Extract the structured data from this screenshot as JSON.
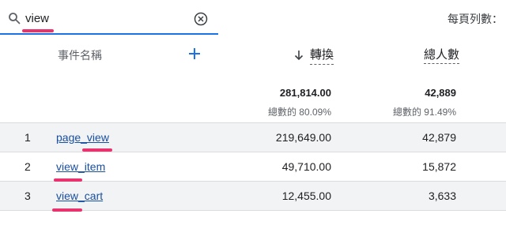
{
  "search": {
    "value": "view",
    "placeholder": ""
  },
  "rows_per_page_label": "每頁列數：",
  "columns": {
    "dimension": "事件名稱",
    "conversions": "轉換",
    "users": "總人數"
  },
  "totals": {
    "conversions": "281,814.00",
    "conversions_pct": "總數的 80.09%",
    "users": "42,889",
    "users_pct": "總數的 91.49%"
  },
  "rows": [
    {
      "index": "1",
      "name": "page_view",
      "conversions": "219,649.00",
      "users": "42,879"
    },
    {
      "index": "2",
      "name": "view_item",
      "conversions": "49,710.00",
      "users": "15,872"
    },
    {
      "index": "3",
      "name": "view_cart",
      "conversions": "12,455.00",
      "users": "3,633"
    }
  ],
  "colors": {
    "accent": "#1a73e8",
    "highlight": "#e8336e",
    "link": "#1a4fa0"
  },
  "icons": {
    "search": "search-icon",
    "clear": "clear-circle-icon",
    "add": "plus-icon",
    "sort": "arrow-down-icon"
  }
}
